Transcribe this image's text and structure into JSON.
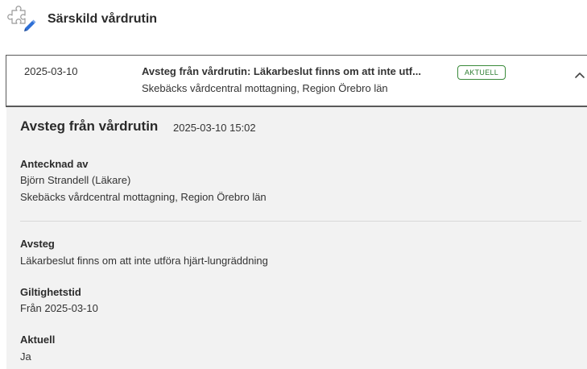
{
  "header": {
    "title": "Särskild vårdrutin",
    "icon": "puzzle-pencil-icon"
  },
  "entry": {
    "date": "2025-03-10",
    "title": "Avsteg från vårdrutin: Läkarbeslut finns om att inte utf...",
    "subtitle": "Skebäcks vårdcentral mottagning, Region Örebro län",
    "badge": "AKTUELL",
    "toggle_icon": "chevron-up-icon"
  },
  "details": {
    "title": "Avsteg från vårdrutin",
    "timestamp": "2025-03-10 15:02",
    "author_label": "Antecknad av",
    "author_name": "Björn Strandell (Läkare)",
    "author_unit": "Skebäcks vårdcentral mottagning, Region Örebro län",
    "deviation_label": "Avsteg",
    "deviation_value": "Läkarbeslut finns om att inte utföra hjärt-lungräddning",
    "validity_label": "Giltighetstid",
    "validity_value": "Från 2025-03-10",
    "current_label": "Aktuell",
    "current_value": "Ja"
  },
  "colors": {
    "badge_green": "#2e7d32",
    "details_bg": "#f2f2f2",
    "icon_blue": "#2d6fd6"
  }
}
